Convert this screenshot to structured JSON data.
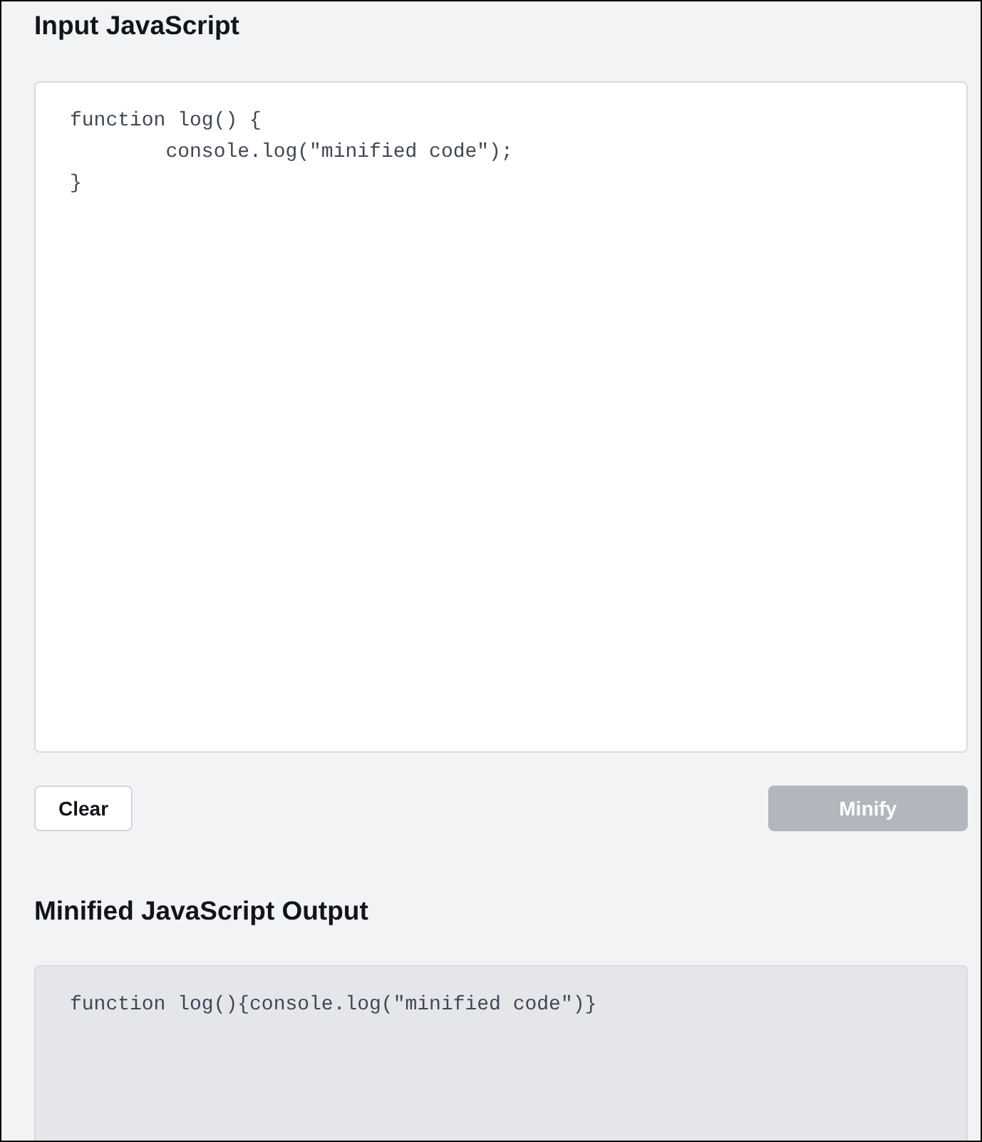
{
  "input": {
    "heading": "Input JavaScript",
    "code": "function log() {\n\tconsole.log(\"minified code\");\n}"
  },
  "buttons": [
    {
      "label": "Clear",
      "kind": "secondary",
      "disabled": false
    },
    {
      "label": "Minify",
      "kind": "primary",
      "disabled": true
    }
  ],
  "output": {
    "heading": "Minified JavaScript Output",
    "code": "function log(){console.log(\"minified code\")}"
  }
}
